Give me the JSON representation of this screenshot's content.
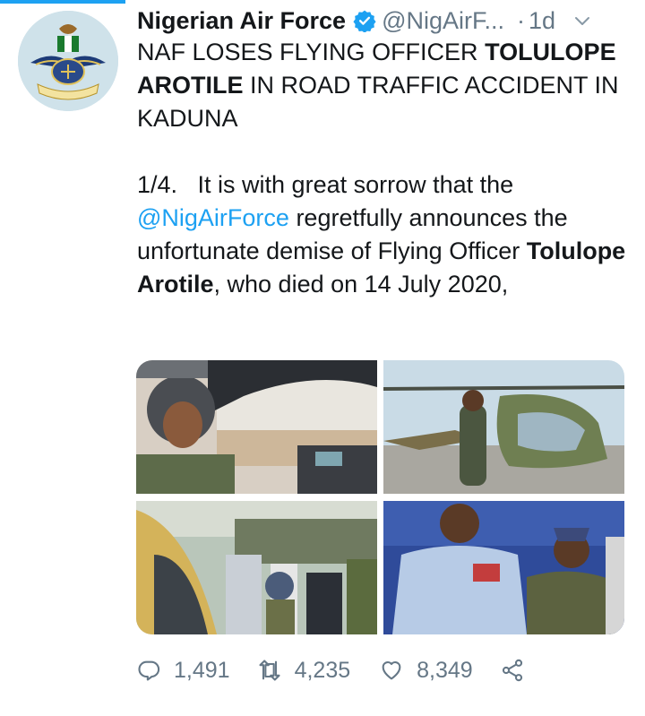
{
  "tweet": {
    "author_name": "Nigerian Air Force",
    "handle": "@NigAirF...",
    "time_separator": "·",
    "time": "1d",
    "headline": {
      "part1": "NAF LOSES FLYING OFFICER ",
      "bold": "TOLULOPE AROTILE",
      "part2": " IN ROAD TRAFFIC ACCIDENT IN KADUNA"
    },
    "body": {
      "prefix": "1/4.   It is with great sorrow that the ",
      "mention": "@NigAirForce",
      "middle": " regretfully announces the unfortunate demise of Flying Officer ",
      "bold_name": "Tolulope Arotile",
      "suffix": ", who died on 14 July 2020,"
    },
    "avatar_text": "NIGERIAN AIR FORCE"
  },
  "media": [
    {
      "icon": "photo-cockpit"
    },
    {
      "icon": "photo-helicopter"
    },
    {
      "icon": "photo-crowd"
    },
    {
      "icon": "photo-officers"
    }
  ],
  "actions": {
    "reply_count": "1,491",
    "retweet_count": "4,235",
    "like_count": "8,349"
  },
  "colors": {
    "accent": "#1da1f2",
    "text": "#14171a",
    "secondary": "#657786"
  }
}
